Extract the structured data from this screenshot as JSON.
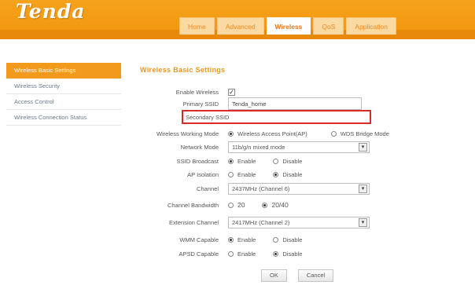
{
  "brand": {
    "logo_text": "Tenda"
  },
  "nav": {
    "tabs": [
      {
        "label": "Home",
        "active": false
      },
      {
        "label": "Advanced",
        "active": false
      },
      {
        "label": "Wireless",
        "active": true
      },
      {
        "label": "QoS",
        "active": false
      },
      {
        "label": "Application",
        "active": false
      }
    ]
  },
  "sidebar": {
    "items": [
      {
        "label": "Wireless Basic Settings",
        "active": true
      },
      {
        "label": "Wireless Security",
        "active": false
      },
      {
        "label": "Access Control",
        "active": false
      },
      {
        "label": "Wireless Connection Status",
        "active": false
      }
    ]
  },
  "form": {
    "title": "Wireless Basic Settings",
    "enable_wireless": {
      "label": "Enable Wireless",
      "checked": true,
      "mark": "✓"
    },
    "primary_ssid": {
      "label": "Primary SSID",
      "value": "Tenda_home"
    },
    "secondary_ssid": {
      "label": "Secondary SSID",
      "value": ""
    },
    "working_mode": {
      "label": "Wireless Working Mode",
      "options": [
        "Wireless Access Point(AP)",
        "WDS Bridge Mode"
      ],
      "selected": 0
    },
    "network_mode": {
      "label": "Network Mode",
      "value": "11b/g/n mixed mode"
    },
    "ssid_broadcast": {
      "label": "SSID Broadcast",
      "options": [
        "Enable",
        "Disable"
      ],
      "selected": 0
    },
    "ap_isolation": {
      "label": "AP Isolation",
      "options": [
        "Enable",
        "Disable"
      ],
      "selected": 1
    },
    "channel": {
      "label": "Channel",
      "value": "2437MHz (Channel 6)"
    },
    "channel_bandwidth": {
      "label": "Channel Bandwidth",
      "options": [
        "20",
        "20/40"
      ],
      "selected": 1
    },
    "extension_channel": {
      "label": "Extension Channel",
      "value": "2417MHz (Channel 2)"
    },
    "wmm_capable": {
      "label": "WMM Capable",
      "options": [
        "Enable",
        "Disable"
      ],
      "selected": 0
    },
    "apsd_capable": {
      "label": "APSD Capable",
      "options": [
        "Enable",
        "Disable"
      ],
      "selected": 1
    },
    "ok_label": "OK",
    "cancel_label": "Cancel"
  },
  "colors": {
    "accent": "#f39a12",
    "highlight": "#d92a2a"
  },
  "icons": {
    "dropdown": "chevron-down-icon"
  }
}
